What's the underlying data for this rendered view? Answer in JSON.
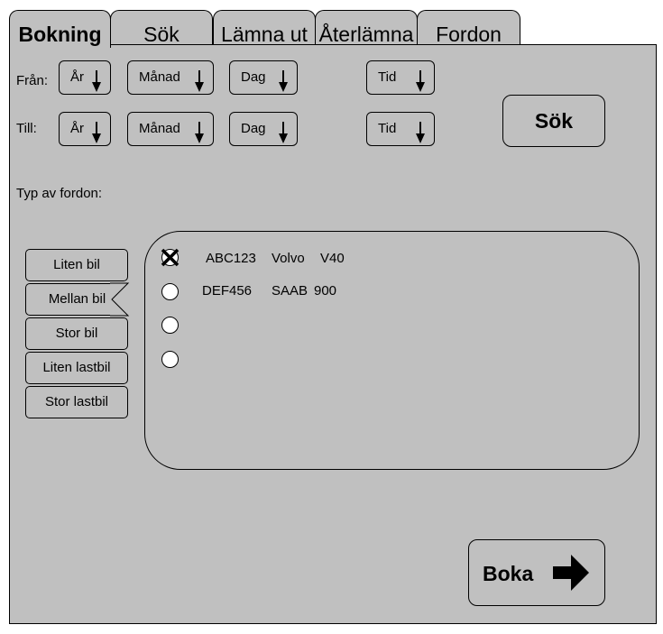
{
  "tabs": [
    "Bokning",
    "Sök",
    "Lämna ut",
    "Återlämna",
    "Fordon"
  ],
  "date_fields": {
    "from_label": "Från:",
    "to_label": "Till:",
    "from": {
      "year": "År",
      "month": "Månad",
      "day": "Dag",
      "time": "Tid"
    },
    "to": {
      "year": "År",
      "month": "Månad",
      "day": "Dag",
      "time": "Tid"
    }
  },
  "search_button": "Sök",
  "vehicle_type_label": "Typ av fordon:",
  "vehicle_types": [
    "Liten bil",
    "Mellan bil",
    "Stor bil",
    "Liten lastbil",
    "Stor lastbil"
  ],
  "selected_vehicle_type": "Mellan bil",
  "vehicles": [
    {
      "reg": "ABC123",
      "make": "Volvo",
      "model": "V40",
      "selected": true
    },
    {
      "reg": "DEF456",
      "make": "SAAB",
      "model": "900",
      "selected": false
    },
    {
      "reg": "",
      "make": "",
      "model": "",
      "selected": false
    },
    {
      "reg": "",
      "make": "",
      "model": "",
      "selected": false
    }
  ],
  "book_button": "Boka",
  "icons": {
    "book": "arrow-right-icon",
    "dropdown": "arrow-down-icon",
    "selected": "x-mark-icon"
  }
}
